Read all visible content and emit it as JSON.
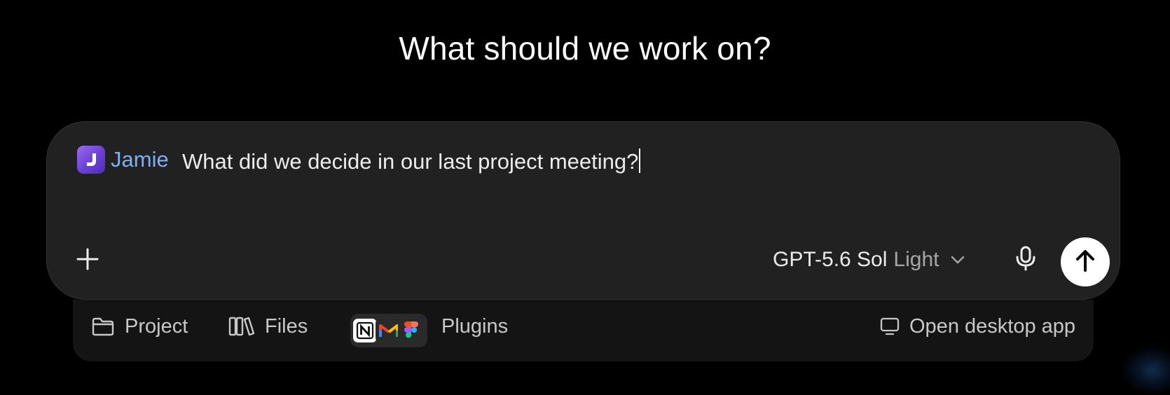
{
  "headline": "What should we work on?",
  "composer": {
    "mention": {
      "avatar_letter": "J",
      "avatar_color": "#7b4fe0",
      "name": "Jamie",
      "name_color": "#7eaef5"
    },
    "prompt_text": "What did we decide in our last project meeting?",
    "attach_icon": "plus-icon",
    "model": {
      "name": "GPT-5.6 Sol",
      "mode": "Light",
      "dropdown_icon": "chevron-down-icon"
    },
    "voice_icon": "microphone-icon",
    "send_icon": "arrow-up-icon"
  },
  "bottom_bar": {
    "project_label": "Project",
    "project_icon": "folder-icon",
    "files_label": "Files",
    "files_icon": "library-icon",
    "plugins_label": "Plugins",
    "plugin_icons": [
      "notion-icon",
      "gmail-icon",
      "figma-icon"
    ],
    "desktop_label": "Open desktop app",
    "desktop_icon": "monitor-icon"
  },
  "colors": {
    "background": "#000000",
    "composer_bg": "#212121",
    "bottom_bar_bg": "#141414",
    "text_primary": "#ececec",
    "text_muted": "#a6a6a6"
  }
}
